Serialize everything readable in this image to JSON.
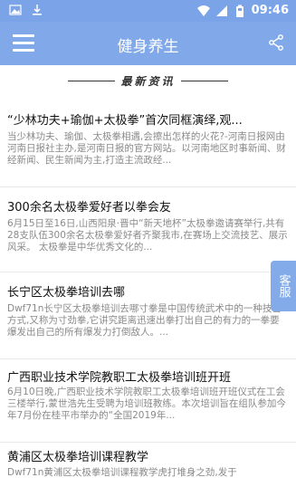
{
  "status": {
    "time": "09:46"
  },
  "appbar": {
    "title": "健身养生"
  },
  "section": {
    "title": "最新资讯"
  },
  "articles": [
    {
      "title": "“少林功夫+瑜伽+太极拳”首次同框演绎,观...",
      "desc": "当少林功夫、瑜伽、太极拳相遇,会擦出怎样的火花?-河南日报网由河南日报社主办,是河南日报的官方网站。以河南地区时事新闻、财经新闻、民生新闻为主,打造主流政经..."
    },
    {
      "title": "300余名太极拳爱好者以拳会友",
      "desc": "6月15日至16日,山西阳泉·晋中“新天地杯”太极拳邀请赛举行,共有28支队伍300余名太极拳爱好者齐聚我市,在赛场上交流技艺、展示风采。 太极拳是中华优秀文化的..."
    },
    {
      "title": "长宁区太极拳培训去哪",
      "desc": "Dwf71n长宁区太极拳培训去哪寸拳是中国传统武术中的一种技击方式,又称为寸劲拳,它讲究距离迅速出拳打出自己的有力的一拳要爆发出自己的所有爆发力打倒敌人。..."
    },
    {
      "title": "广西职业技术学院教职工太极拳培训班开班",
      "desc": "6月10日晚,广西职业技术学院教职工太极拳培训班开班仪式在工会三楼举行,蒙世浩先生受聘为培训班教练。本次培训旨在组队参加今年7月份在桂平市举办的“全国2019年..."
    },
    {
      "title": "黄浦区太极拳培训课程教学",
      "desc": "Dwf71n黄浦区太极拳培训课程教学虎打堆身之劲,发于"
    }
  ],
  "float_button": {
    "label": "客服"
  }
}
